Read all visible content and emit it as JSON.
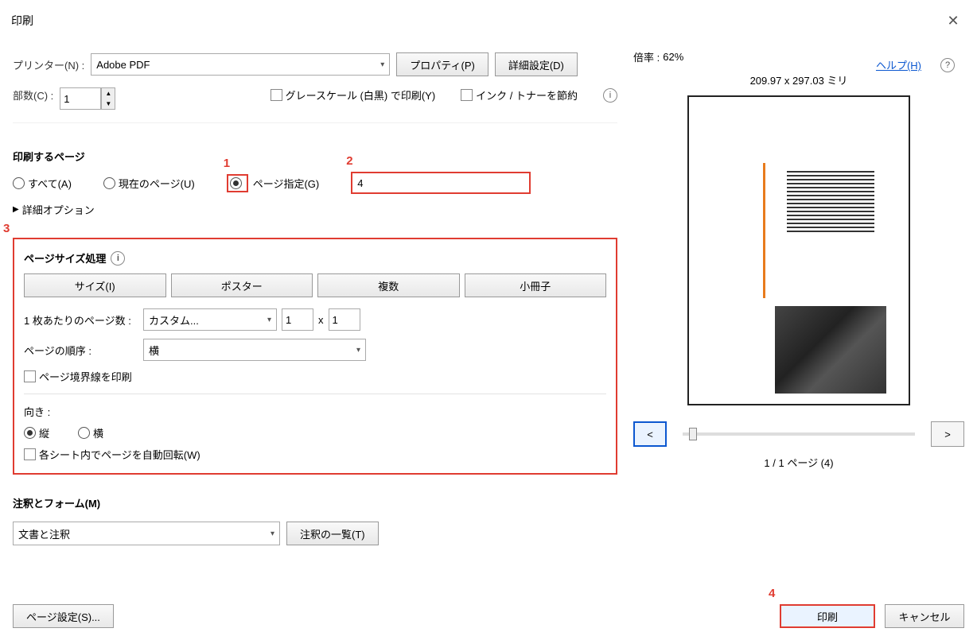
{
  "title": "印刷",
  "printer": {
    "label": "プリンター(N) :",
    "value": "Adobe PDF",
    "properties_btn": "プロパティ(P)",
    "advanced_btn": "詳細設定(D)",
    "help": "ヘルプ(H)"
  },
  "copies": {
    "label": "部数(C) :",
    "value": "1"
  },
  "options": {
    "grayscale": "グレースケール (白黒) で印刷(Y)",
    "save_ink": "インク / トナーを節約"
  },
  "pages": {
    "heading": "印刷するページ",
    "all": "すべて(A)",
    "current": "現在のページ(U)",
    "range": "ページ指定(G)",
    "range_value": "4",
    "more": "詳細オプション"
  },
  "sizing": {
    "heading": "ページサイズ処理",
    "size_btn": "サイズ(I)",
    "poster_btn": "ポスター",
    "multi_btn": "複数",
    "booklet_btn": "小冊子",
    "per_sheet_label": "1 枚あたりのページ数 :",
    "per_sheet_value": "カスタム...",
    "per_sheet_x": "1",
    "per_sheet_y": "1",
    "x_separator": "x",
    "order_label": "ページの順序 :",
    "order_value": "横",
    "border": "ページ境界線を印刷",
    "orient_label": "向き :",
    "orient_portrait": "縦",
    "orient_landscape": "横",
    "auto_rotate": "各シート内でページを自動回転(W)"
  },
  "comments": {
    "heading": "注釈とフォーム(M)",
    "value": "文書と注釈",
    "list_btn": "注釈の一覧(T)"
  },
  "preview": {
    "scale_label": "倍率 :",
    "scale_value": "62%",
    "dimensions": "209.97 x 297.03 ミリ",
    "prev": "<",
    "next": ">",
    "page_info": "1 / 1 ページ (4)"
  },
  "footer": {
    "page_setup": "ページ設定(S)...",
    "print": "印刷",
    "cancel": "キャンセル"
  },
  "annotations": {
    "n1": "1",
    "n2": "2",
    "n3": "3",
    "n4": "4"
  }
}
